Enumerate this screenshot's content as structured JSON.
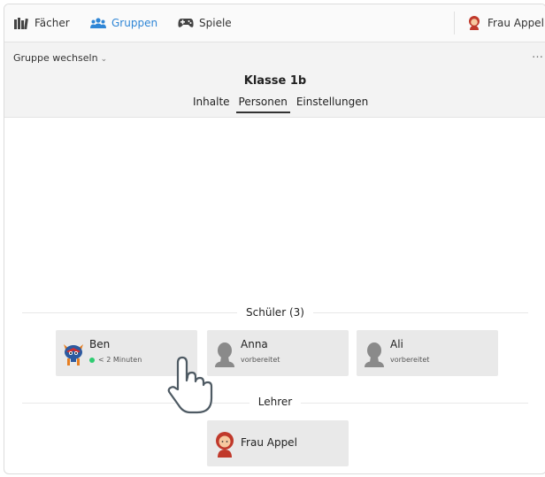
{
  "nav": {
    "items": [
      {
        "label": "Fächer",
        "icon": "books-icon"
      },
      {
        "label": "Gruppen",
        "icon": "users-icon",
        "active": true
      },
      {
        "label": "Spiele",
        "icon": "gamepad-icon"
      }
    ],
    "user": {
      "label": "Frau Appel",
      "icon": "teacher-avatar-icon"
    }
  },
  "group": {
    "switch_label": "Gruppe wechseln",
    "more_label": "…",
    "title": "Klasse 1b",
    "tabs": [
      {
        "label": "Inhalte"
      },
      {
        "label": "Personen",
        "active": true
      },
      {
        "label": "Einstellungen"
      }
    ]
  },
  "students": {
    "title": "Schüler (3)",
    "items": [
      {
        "name": "Ben",
        "status": "< 2 Minuten",
        "online": true,
        "avatar": "monster-avatar-icon"
      },
      {
        "name": "Anna",
        "status": "vorbereitet",
        "avatar": "person-placeholder-icon"
      },
      {
        "name": "Ali",
        "status": "vorbereitet",
        "avatar": "person-placeholder-icon"
      }
    ]
  },
  "teachers": {
    "title": "Lehrer",
    "items": [
      {
        "name": "Frau Appel",
        "avatar": "teacher-avatar-icon"
      }
    ]
  },
  "colors": {
    "accent": "#2f86d6",
    "online": "#2ecc71",
    "card_bg": "#e9e9e9",
    "header_bg": "#f3f3f3"
  }
}
